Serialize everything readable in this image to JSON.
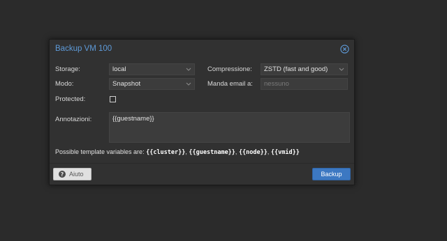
{
  "dialog": {
    "title": "Backup VM 100"
  },
  "form": {
    "storage_label": "Storage:",
    "storage_value": "local",
    "mode_label": "Modo:",
    "mode_value": "Snapshot",
    "protected_label": "Protected:",
    "protected_checked": false,
    "compression_label": "Compressione:",
    "compression_value": "ZSTD (fast and good)",
    "email_label": "Manda email a:",
    "email_placeholder": "nessuno",
    "notes_label": "Annotazioni:",
    "notes_value": "{{guestname}}"
  },
  "hint": {
    "prefix": "Possible template variables are: ",
    "vars": [
      "{{cluster}}",
      "{{guestname}}",
      "{{node}}",
      "{{vmid}}"
    ],
    "separator": ", "
  },
  "footer": {
    "help_label": "Aiuto",
    "backup_label": "Backup"
  },
  "colors": {
    "title": "#5e9ad8",
    "primary_button": "#3c78c2"
  },
  "icons": {
    "close": "close-circle-icon",
    "help": "question-circle-icon",
    "dropdown": "chevron-down-icon"
  }
}
